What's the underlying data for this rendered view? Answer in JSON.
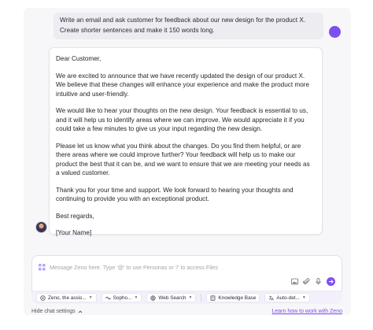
{
  "user_message": {
    "text": "Write an email and ask customer for feedback about our new design for the product X. Create shorter sentences and make it 150 words long."
  },
  "assistant_message": {
    "paragraphs": [
      "Dear Customer,",
      "We are excited to announce that we have recently updated the design of our product X. We believe that these changes will enhance your experience and make the product more intuitive and user-friendly.",
      "We would like to hear your thoughts on the new design. Your feedback is essential to us, and it will help us to identify areas where we can improve. We would appreciate it if you could take a few minutes to give us your input regarding the new design.",
      "Please let us know what you think about the changes. Do you find them helpful, or are there areas where we could improve further? Your feedback will help us to make our product the best that it can be, and we want to ensure that we are meeting your needs as a valued customer.",
      "Thank you for your time and support. We look forward to hearing your thoughts and continuing to provide you with an exceptional product.",
      "Best regards,",
      "[Your Name]"
    ]
  },
  "composer": {
    "placeholder": "Message Zeno here. Type '@' to use Personas or '/' to access Files"
  },
  "toolbar": {
    "persona_label": "Zeno, the assis...",
    "model_label": "Sopho...",
    "web_search_label": "Web Search",
    "knowledge_base_label": "Knowledge Base",
    "auto_detect_label": "Auto-det..."
  },
  "footer": {
    "hide_settings_label": "Hide chat settings",
    "learn_link_label": "Learn how to work with Zeno"
  },
  "colors": {
    "accent": "#7d4ff0",
    "user_bubble": "#ececf1"
  }
}
